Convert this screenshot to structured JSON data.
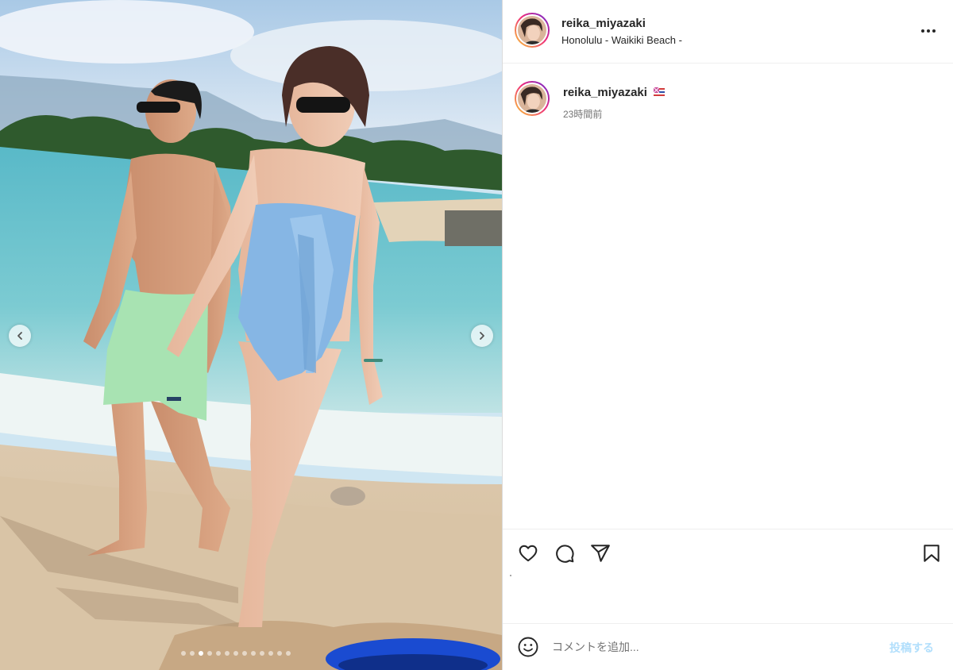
{
  "post": {
    "username": "reika_miyazaki",
    "location": "Honolulu - Waikiki Beach -",
    "caption_username": "reika_miyazaki",
    "caption_emoji": "hawaii-flag-icon",
    "timestamp": "23時間前"
  },
  "photo": {
    "carousel_total": 13,
    "carousel_active_index": 2,
    "prev_icon": "chevron-left-icon",
    "next_icon": "chevron-right-icon"
  },
  "actions": {
    "like_icon": "heart-icon",
    "comment_icon": "comment-icon",
    "share_icon": "paper-plane-icon",
    "save_icon": "bookmark-icon",
    "more_icon": "more-horizontal-icon"
  },
  "comment_box": {
    "placeholder": "コメントを追加...",
    "post_label": "投稿する",
    "emoji_icon": "smiley-icon"
  },
  "colors": {
    "post_button": "#b2dffc",
    "secondary_text": "#737373",
    "divider": "#efefef"
  }
}
